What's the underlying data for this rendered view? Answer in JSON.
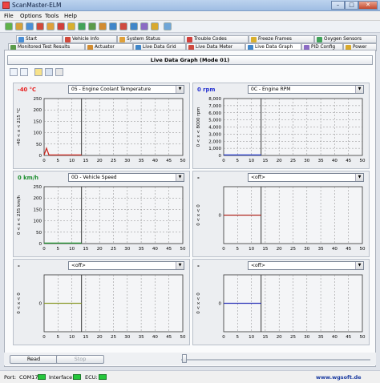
{
  "window": {
    "title": "ScanMaster-ELM",
    "minimize": "–",
    "maximize": "□",
    "close": "✕"
  },
  "menu": [
    "File",
    "Options",
    "Tools",
    "Help"
  ],
  "tabs_top": [
    {
      "label": "Start",
      "color": "#4a8fd6"
    },
    {
      "label": "Vehicle Info",
      "color": "#d14a3c"
    },
    {
      "label": "System Status",
      "color": "#e0a13a"
    },
    {
      "label": "Trouble Codes",
      "color": "#d1403c"
    },
    {
      "label": "Freeze Frames",
      "color": "#d9b02e"
    },
    {
      "label": "Oxygen Sensors",
      "color": "#42a35a"
    }
  ],
  "tabs_bottom": [
    {
      "label": "Monitored Test Results",
      "color": "#5a9b49"
    },
    {
      "label": "Actuator",
      "color": "#d28c30"
    },
    {
      "label": "Live Data Grid",
      "color": "#3f86c9"
    },
    {
      "label": "Live Data Meter",
      "color": "#cf4a3f"
    },
    {
      "label": "Live Data Graph",
      "color": "#3f86c9"
    },
    {
      "label": "PID Config",
      "color": "#8b6bc4"
    },
    {
      "label": "Power",
      "color": "#d8a92d"
    }
  ],
  "page_title": "Live Data Graph (Mode 01)",
  "graphs": [
    {
      "value": "-40 °C",
      "value_color": "#e82020",
      "sensor": "05 - Engine Coolant Temperature",
      "axis_label": "-40 < x < 215 °C",
      "y_ticks": [
        "250",
        "200",
        "150",
        "100",
        "50",
        "0"
      ],
      "x_ticks": [
        "0",
        "5",
        "10",
        "15",
        "20",
        "25",
        "30",
        "35",
        "40",
        "45",
        "50"
      ],
      "trace_color": "#cc2a22",
      "cursor": 13.5
    },
    {
      "value": "0 rpm",
      "value_color": "#2430d0",
      "sensor": "0C - Engine RPM",
      "axis_label": "0 < x < 8000 rpm",
      "y_ticks": [
        "8,000",
        "7,000",
        "6,000",
        "5,000",
        "4,000",
        "3,000",
        "2,000",
        "1,000",
        "0"
      ],
      "x_ticks": [
        "0",
        "5",
        "10",
        "15",
        "20",
        "25",
        "30",
        "35",
        "40",
        "45",
        "50"
      ],
      "trace_color": "#2037c7",
      "cursor": 13.5
    },
    {
      "value": "0 km/h",
      "value_color": "#1b8e2d",
      "sensor": "0D - Vehicle Speed",
      "axis_label": "0 < x < 255 km/h",
      "y_ticks": [
        "250",
        "200",
        "150",
        "100",
        "50",
        "0"
      ],
      "x_ticks": [
        "0",
        "5",
        "10",
        "15",
        "20",
        "25",
        "30",
        "35",
        "40",
        "45",
        "50"
      ],
      "trace_color": "#1c8f2a",
      "cursor": 13.5
    },
    {
      "value": "-",
      "value_color": "#000000",
      "sensor": "<off>",
      "axis_label": "0 < x < 0",
      "y_ticks": [
        "0"
      ],
      "x_ticks": [
        "0",
        "5",
        "10",
        "15",
        "20",
        "25",
        "30",
        "35",
        "40",
        "45",
        "50"
      ],
      "trace_color": "#b02a22",
      "cursor": 13.5
    },
    {
      "value": "-",
      "value_color": "#000000",
      "sensor": "<off>",
      "axis_label": "0 < x < 0",
      "y_ticks": [
        "0"
      ],
      "x_ticks": [
        "0",
        "5",
        "10",
        "15",
        "20",
        "25",
        "30",
        "35",
        "40",
        "45",
        "50"
      ],
      "trace_color": "#8a9a2a",
      "cursor": 13.5
    },
    {
      "value": "-",
      "value_color": "#000000",
      "sensor": "<off>",
      "axis_label": "0 < x < 0",
      "y_ticks": [
        "0"
      ],
      "x_ticks": [
        "0",
        "5",
        "10",
        "15",
        "20",
        "25",
        "30",
        "35",
        "40",
        "45",
        "50"
      ],
      "trace_color": "#2a32b8",
      "cursor": 13.5
    }
  ],
  "buttons": {
    "read": "Read",
    "stop": "Stop"
  },
  "status": {
    "port_label": "Port:",
    "port_value": "COM17",
    "interface_label": "Interface:",
    "ecu_label": "ECU:",
    "website": "www.wgsoft.de"
  },
  "colors": {
    "led_on": "#25c73b",
    "grid_bg": "#eceef1"
  }
}
